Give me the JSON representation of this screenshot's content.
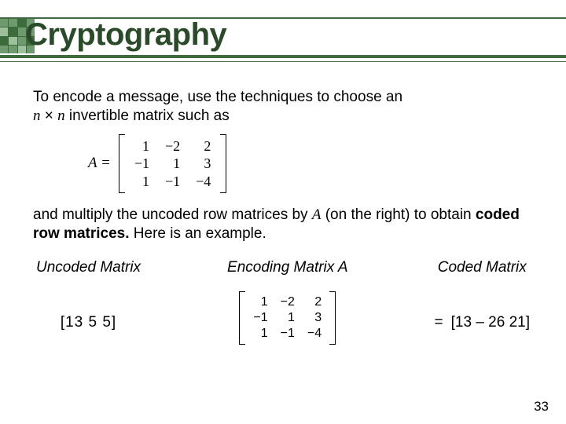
{
  "header": {
    "title": "Cryptography"
  },
  "body": {
    "p1_a": "To encode a message, use the techniques to choose an",
    "p1_b_prefix": "n",
    "p1_b_times": " × ",
    "p1_b_suffix": "n",
    "p1_b_tail": " invertible matrix such as",
    "matrixA_label": "A =",
    "matrixA": [
      [
        "1",
        "−2",
        "2"
      ],
      [
        "−1",
        "1",
        "3"
      ],
      [
        "1",
        "−1",
        "−4"
      ]
    ],
    "p2_a": "and multiply the uncoded row matrices by ",
    "p2_ital": "A",
    "p2_b": " (on the right) to obtain ",
    "p2_bold": "coded row matrices.",
    "p2_c": " Here is an example."
  },
  "columns": {
    "uncoded_header": "Uncoded Matrix",
    "encoding_header": "Encoding Matrix A",
    "coded_header": "Coded Matrix",
    "uncoded_value": "[13    5    5]",
    "encoding_matrix": [
      [
        "1",
        "−2",
        "2"
      ],
      [
        "−1",
        "1",
        "3"
      ],
      [
        "1",
        "−1",
        "−4"
      ]
    ],
    "equals": "=",
    "coded_value": "[13    – 26    21]"
  },
  "page_number": "33"
}
